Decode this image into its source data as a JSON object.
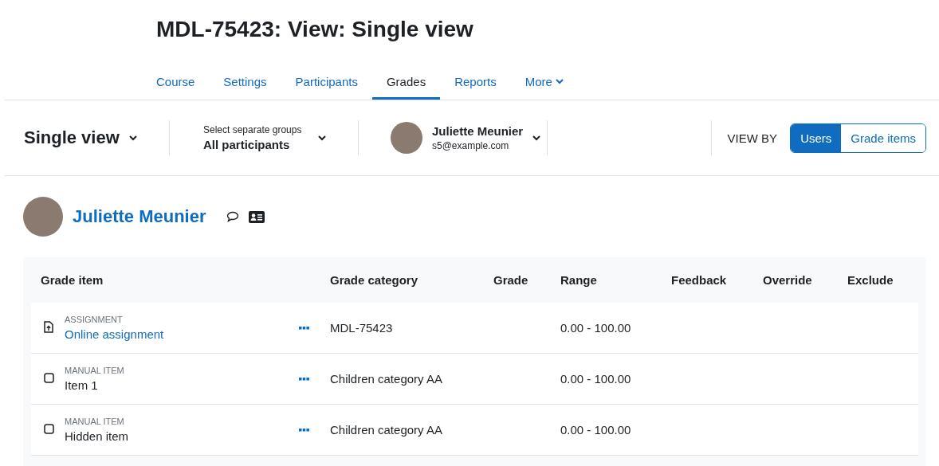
{
  "page_title": "MDL-75423: View: Single view",
  "nav": [
    {
      "label": "Course",
      "selected": false,
      "dropdown": false
    },
    {
      "label": "Settings",
      "selected": false,
      "dropdown": false
    },
    {
      "label": "Participants",
      "selected": false,
      "dropdown": false
    },
    {
      "label": "Grades",
      "selected": true,
      "dropdown": false
    },
    {
      "label": "Reports",
      "selected": false,
      "dropdown": false
    },
    {
      "label": "More",
      "selected": false,
      "dropdown": true
    }
  ],
  "toolbar": {
    "view_selector": "Single view",
    "group_selector": {
      "label": "Select separate groups",
      "value": "All participants"
    },
    "user_selector": {
      "name": "Juliette Meunier",
      "email": "s5@example.com"
    },
    "view_by": {
      "label": "VIEW BY",
      "options": [
        {
          "label": "Users",
          "selected": true
        },
        {
          "label": "Grade items",
          "selected": false
        }
      ]
    }
  },
  "user_heading": {
    "name": "Juliette Meunier"
  },
  "table": {
    "columns": [
      "Grade item",
      "Grade category",
      "Grade",
      "Range",
      "Feedback",
      "Override",
      "Exclude"
    ],
    "rows": [
      {
        "kind": "assignment",
        "type_label": "ASSIGNMENT",
        "name": "Online assignment",
        "category": "MDL-75423",
        "range": "0.00 - 100.00"
      },
      {
        "kind": "manual",
        "type_label": "MANUAL ITEM",
        "name": "Item 1",
        "category": "Children category AA",
        "range": "0.00 - 100.00"
      },
      {
        "kind": "manual",
        "type_label": "MANUAL ITEM",
        "name": "Hidden item",
        "category": "Children category AA",
        "range": "0.00 - 100.00"
      }
    ]
  }
}
